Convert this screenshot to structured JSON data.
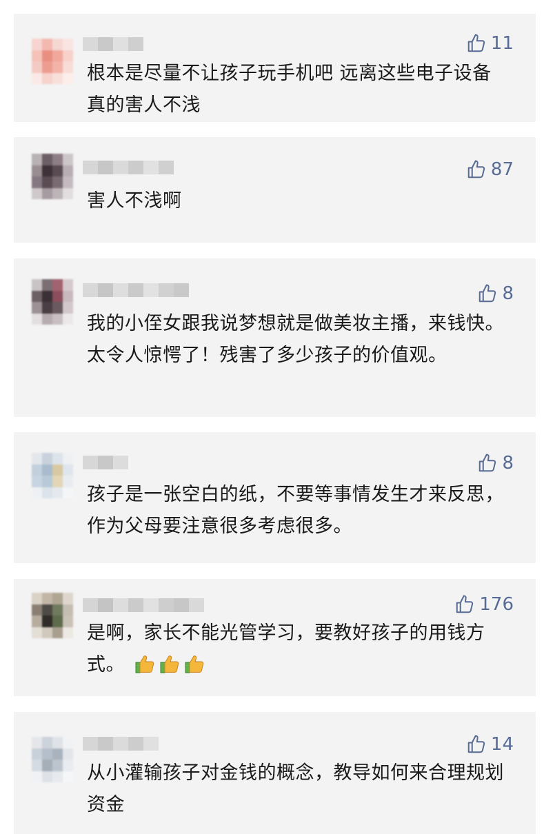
{
  "comments": [
    {
      "likes": "11",
      "text": "根本是尽量不让孩子玩手机吧 远离这些电子设备 真的害人不浅",
      "avatar_colors": [
        "#f7d4cf",
        "#f3b9b0",
        "#f6d8d3",
        "#f9e4e1",
        "#f5c2b8",
        "#e98f82",
        "#f0a89c",
        "#f7d1ca",
        "#f4cbc4",
        "#ed9c90",
        "#f2b3a8",
        "#f8dcd7",
        "#fae9e6",
        "#f6d3cc",
        "#f8dfda",
        "#fbeeeb"
      ],
      "name_colors": [
        "#d9d9d9",
        "#c9c9c9",
        "#e0e0e0",
        "#cfcfcf"
      ]
    },
    {
      "likes": "87",
      "text": "害人不浅啊",
      "avatar_colors": [
        "#b8b2b5",
        "#6c5f66",
        "#8e7f86",
        "#ccc6c8",
        "#9a8d92",
        "#3f3238",
        "#5a4a52",
        "#b6aeb2",
        "#857880",
        "#5b4b53",
        "#7a6b72",
        "#c3bbbf",
        "#cfc9cb",
        "#a69ba0",
        "#bdb4b8",
        "#e2dddf"
      ],
      "name_colors": [
        "#d6d6d6",
        "#c7c7c7",
        "#dadada",
        "#cccccc",
        "#e1e1e1",
        "#d0d0d0"
      ]
    },
    {
      "likes": "8",
      "text": "我的小侄女跟我说梦想就是做美妆主播，来钱快。太令人惊愕了！残害了多少孩子的价值观。",
      "avatar_colors": [
        "#c9c3c6",
        "#7b6f74",
        "#a3626f",
        "#d6c9cd",
        "#6d6065",
        "#3b3035",
        "#8a4e5c",
        "#c8b9be",
        "#9d9195",
        "#4a3f44",
        "#6a5a60",
        "#d2c8cb",
        "#e3dfe0",
        "#b7acb0",
        "#c8bfc2",
        "#ece8e9"
      ],
      "name_colors": [
        "#d8d8d8",
        "#c6c6c6",
        "#dedede",
        "#cacaca",
        "#e2e2e2",
        "#d1d1d1",
        "#c9c9c9"
      ]
    },
    {
      "likes": "8",
      "text": "孩子是一张空白的纸，不要等事情发生才来反思，作为父母要注意很多考虑很多。",
      "avatar_colors": [
        "#e3e6ea",
        "#c9d2dc",
        "#dde3ea",
        "#eef0f2",
        "#c2cfdc",
        "#a9bccd",
        "#d9c9a2",
        "#dfe5ec",
        "#c7d4e1",
        "#b8c9d8",
        "#e2d6b6",
        "#e8ecf0",
        "#eef1f4",
        "#dbe3eb",
        "#e5e9ee",
        "#f3f5f7"
      ],
      "name_colors": [
        "#d7d7d7",
        "#c8c8c8",
        "#dcdcdc"
      ]
    },
    {
      "likes": "176",
      "text": "是啊，家长不能光管学习，要教好孩子的用钱方式。",
      "avatar_colors": [
        "#d9d2c6",
        "#c2b6a6",
        "#b0a593",
        "#dcd6cc",
        "#8a7f73",
        "#4e4a46",
        "#6f7a5e",
        "#c4bdb2",
        "#b7ad9e",
        "#2f2c2a",
        "#5e6b4c",
        "#c9c2b6",
        "#e3ded6",
        "#d1c9bc",
        "#a99f8f",
        "#ece8e2"
      ],
      "name_colors": [
        "#d5d5d5",
        "#c4c4c4",
        "#dddddd",
        "#cbcbcb",
        "#e1e1e1",
        "#cecece",
        "#c7c7c7",
        "#d9d9d9"
      ]
    },
    {
      "likes": "14",
      "text": "从小灌输孩子对金钱的概念，教导如何来合理规划资金",
      "avatar_colors": [
        "#e4e6ea",
        "#cdd3da",
        "#dfe3e8",
        "#f0f2f4",
        "#c8d0d9",
        "#b5bfcb",
        "#aab3bd",
        "#e2e6ea",
        "#d5dbe2",
        "#a6aeb8",
        "#bcc4cd",
        "#e8ebef",
        "#eff1f4",
        "#dee2e7",
        "#e6e9ed",
        "#f4f6f7"
      ],
      "name_colors": [
        "#d6d6d6",
        "#c9c9c9",
        "#dbdbdb",
        "#cdcdcd",
        "#e0e0e0"
      ]
    }
  ],
  "colors": {
    "card_background": "#f3f3f3",
    "like_color": "#576b95",
    "text_color": "#1a1a1a",
    "emoji_thumb_color": "#f5b73b"
  },
  "icons": {
    "like": "thumbs-up-outline-icon",
    "emoji": "thumbs-up-emoji-icon"
  }
}
